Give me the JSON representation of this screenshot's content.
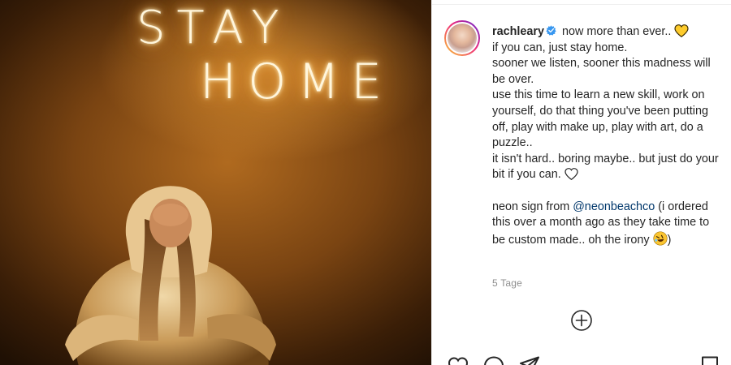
{
  "photo": {
    "neon_line_1": "STAY",
    "neon_line_2": "HOME"
  },
  "post": {
    "username": "rachleary",
    "verified_icon": "verified-badge-icon",
    "caption_intro": "now more than ever..",
    "lines": [
      "if you can, just stay home.",
      "sooner we listen, sooner this madness will be over.",
      "use this time to learn a new skill, work on yourself, do that thing you've been putting off, play with make up, play with art, do a puzzle..",
      "it isn't hard.. boring maybe.. but just do your bit if you can."
    ],
    "credit_prefix": "neon sign from",
    "mention": "@neonbeachco",
    "credit_rest": "(i ordered this over a month ago as they take time to be custom made.. oh the irony",
    "credit_close": ")",
    "timestamp": "5 Tage",
    "emojis": [
      "yellow-heart-icon",
      "white-heart-icon",
      "rolling-laughing-face-icon"
    ]
  },
  "actions": [
    "heart-icon",
    "comment-icon",
    "share-icon",
    "bookmark-icon",
    "add-comment-icon"
  ],
  "colors": {
    "text": "#262626",
    "secondary": "#8e8e8e",
    "link": "#00376b",
    "verified": "#3897f0",
    "neon": "#fff6dc"
  }
}
